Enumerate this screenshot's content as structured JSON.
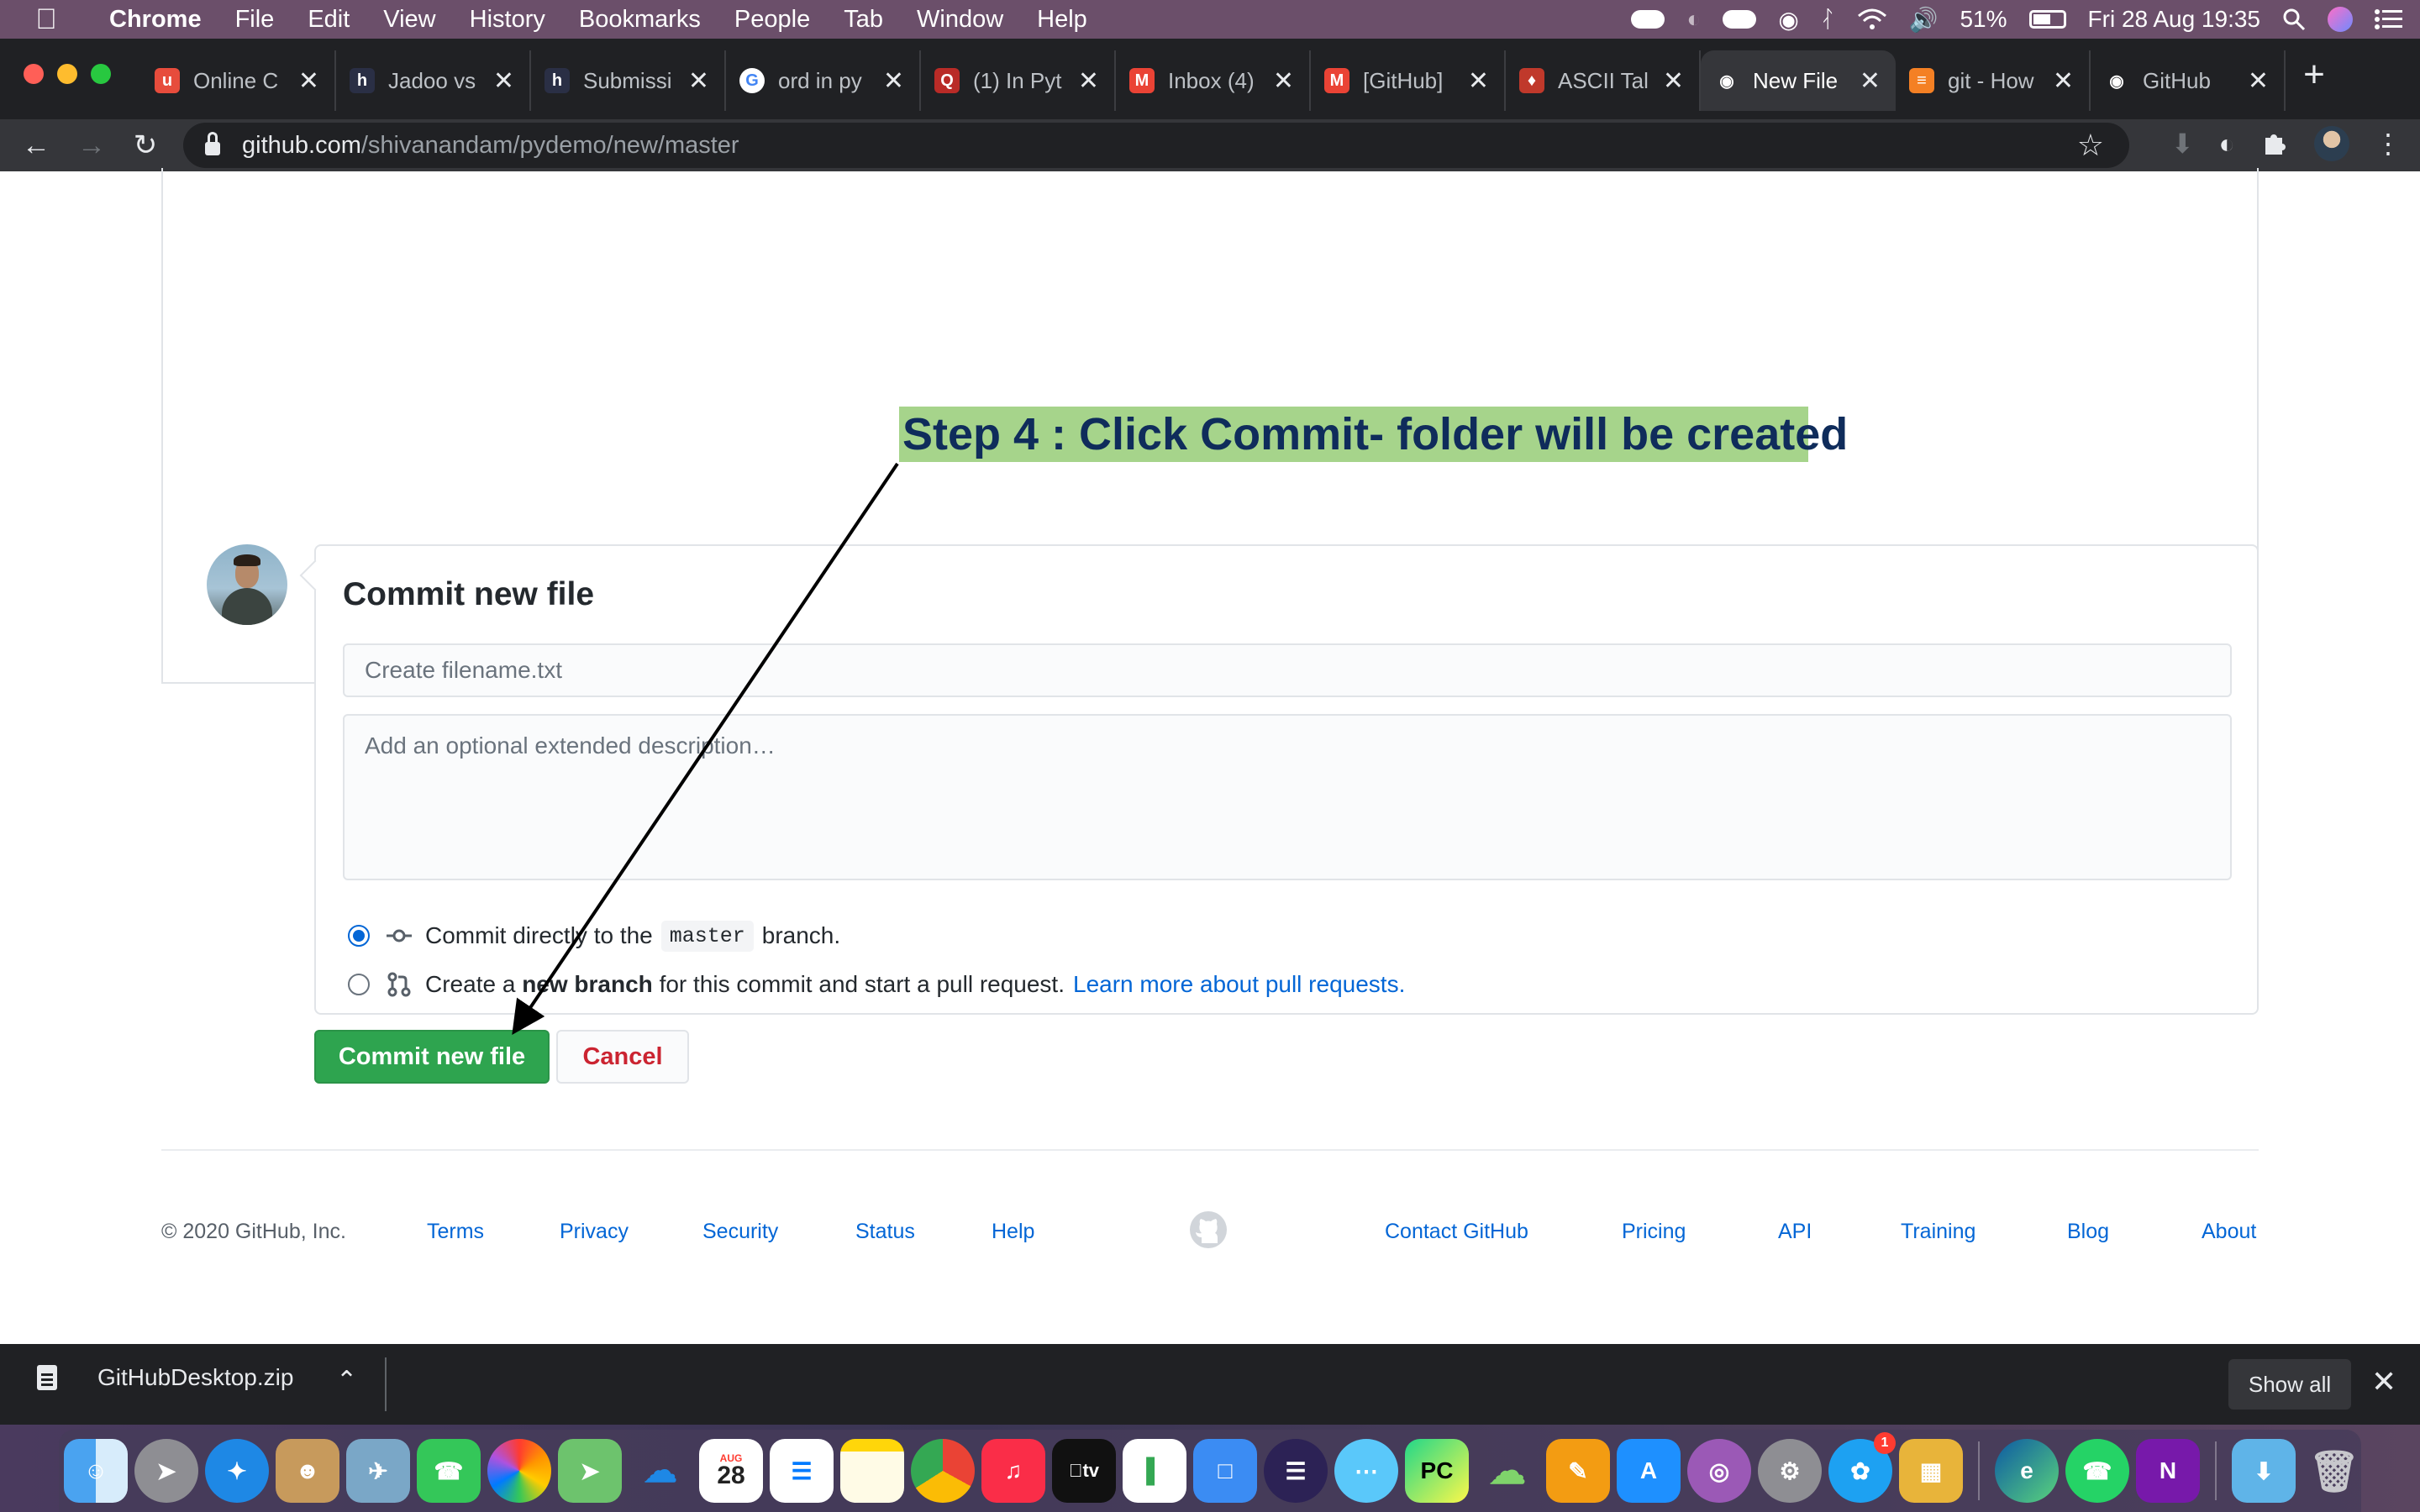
{
  "menubar": {
    "app_name": "Chrome",
    "items": [
      "File",
      "Edit",
      "View",
      "History",
      "Bookmarks",
      "People",
      "Tab",
      "Window",
      "Help"
    ],
    "battery": "51%",
    "datetime": "Fri 28 Aug  19:35"
  },
  "tabs": [
    {
      "title": "Online C",
      "icon": "udemy-icon",
      "color": "#e74c3c"
    },
    {
      "title": "Jadoo vs",
      "icon": "hackerrank-icon",
      "color": "#2a2f45"
    },
    {
      "title": "Submissi",
      "icon": "hackerrank-icon",
      "color": "#2a2f45"
    },
    {
      "title": "ord in py",
      "icon": "google-icon",
      "color": "#ffffff"
    },
    {
      "title": "(1) In Pyt",
      "icon": "quora-icon",
      "color": "#b92b27"
    },
    {
      "title": "Inbox (4)",
      "icon": "gmail-icon",
      "color": "#ea4335"
    },
    {
      "title": "[GitHub]",
      "icon": "gmail-icon",
      "color": "#ea4335"
    },
    {
      "title": "ASCII Tal",
      "icon": "ascii-icon",
      "color": "#c0392b"
    },
    {
      "title": "New File",
      "icon": "github-icon",
      "color": "#ffffff",
      "active": true
    },
    {
      "title": "git - How",
      "icon": "stackoverflow-icon",
      "color": "#f48024"
    },
    {
      "title": "GitHub",
      "icon": "github-icon",
      "color": "#ffffff"
    }
  ],
  "address_bar": {
    "host": "github.com",
    "path": "/shivanandam/pydemo/new/master"
  },
  "annotation": {
    "text": "Step 4 : Click Commit- folder will be created"
  },
  "commit": {
    "title": "Commit new file",
    "filename_placeholder": "Create filename.txt",
    "description_placeholder": "Add an optional extended description…",
    "option_direct": {
      "prefix": "Commit directly to the",
      "branch": "master",
      "suffix": "branch.",
      "checked": true
    },
    "option_new_branch": {
      "prefix": "Create a",
      "bold": "new branch",
      "suffix": "for this commit and start a pull request.",
      "link": "Learn more about pull requests.",
      "checked": false
    },
    "commit_button": "Commit new file",
    "cancel_button": "Cancel"
  },
  "footer": {
    "copyright": "© 2020 GitHub, Inc.",
    "links_left": [
      "Terms",
      "Privacy",
      "Security",
      "Status",
      "Help"
    ],
    "links_right": [
      "Contact GitHub",
      "Pricing",
      "API",
      "Training",
      "Blog",
      "About"
    ]
  },
  "download_bar": {
    "file": "GitHubDesktop.zip",
    "show_all": "Show all"
  },
  "dock": {
    "twitter_badge": "1",
    "calendar_month": "AUG",
    "calendar_day": "28"
  },
  "colors": {
    "primary_green": "#2ea44f",
    "link_blue": "#0366d6",
    "cancel_red": "#cb2431",
    "annotation_bg": "#a6d48b",
    "annotation_text": "#0f2c5b"
  }
}
